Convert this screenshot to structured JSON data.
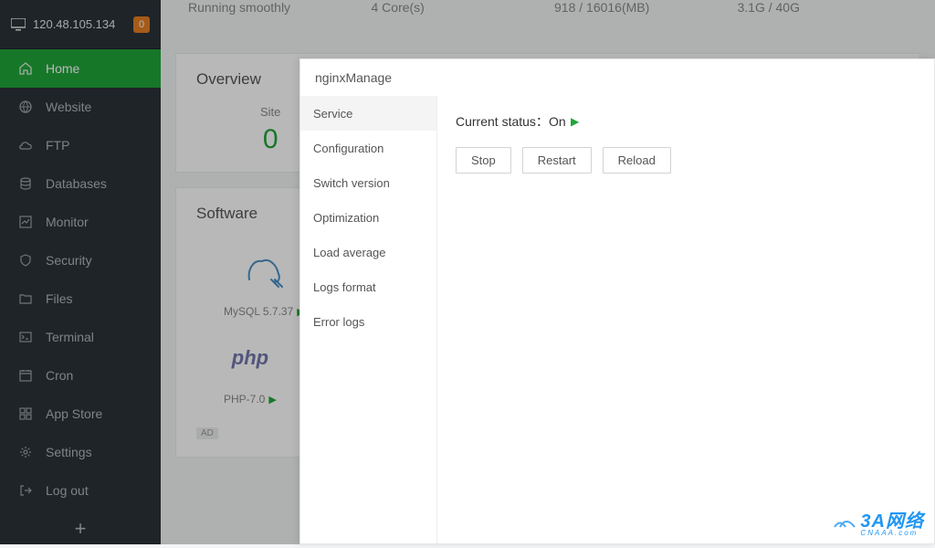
{
  "header": {
    "ip": "120.48.105.134",
    "badge": "0"
  },
  "sidebar": {
    "items": [
      {
        "label": "Home"
      },
      {
        "label": "Website"
      },
      {
        "label": "FTP"
      },
      {
        "label": "Databases"
      },
      {
        "label": "Monitor"
      },
      {
        "label": "Security"
      },
      {
        "label": "Files"
      },
      {
        "label": "Terminal"
      },
      {
        "label": "Cron"
      },
      {
        "label": "App Store"
      },
      {
        "label": "Settings"
      },
      {
        "label": "Log out"
      }
    ]
  },
  "status": {
    "text": "Running smoothly",
    "cores": "4 Core(s)",
    "memory": "918 / 16016(MB)",
    "disk": "3.1G / 40G"
  },
  "overview": {
    "title": "Overview",
    "site_label": "Site",
    "site_count": "0"
  },
  "software": {
    "title": "Software",
    "items": [
      {
        "name": "MySQL 5.7.37"
      },
      {
        "name": "PHP-7.0"
      }
    ],
    "ad": "AD"
  },
  "modal": {
    "title": "nginxManage",
    "nav": [
      "Service",
      "Configuration",
      "Switch version",
      "Optimization",
      "Load average",
      "Logs format",
      "Error logs"
    ],
    "status_label": "Current status：",
    "status_value": "On",
    "buttons": {
      "stop": "Stop",
      "restart": "Restart",
      "reload": "Reload"
    }
  },
  "watermark": {
    "text": "3A网络",
    "sub": "CNAAA.com"
  }
}
